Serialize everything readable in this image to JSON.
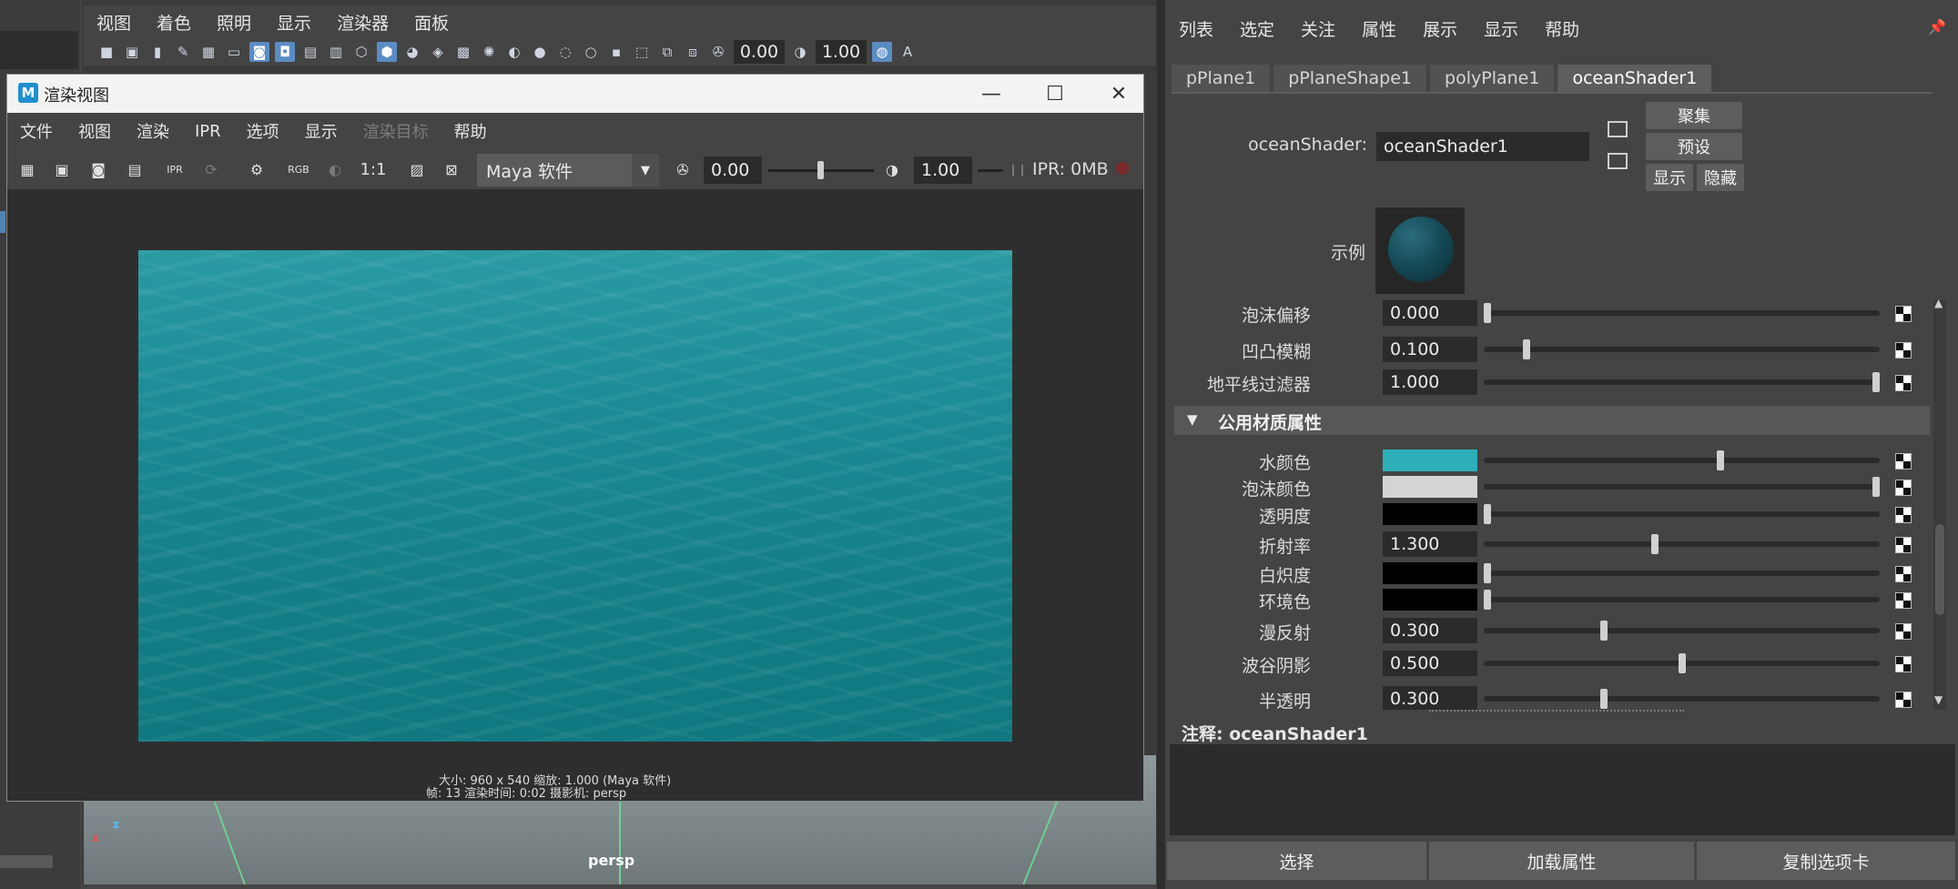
{
  "viewport": {
    "menu": [
      "视图",
      "着色",
      "照明",
      "显示",
      "渲染器",
      "面板"
    ],
    "toolbar": {
      "field1": "0.00",
      "field2": "1.00",
      "badge": "A"
    },
    "label": "persp",
    "axis_x": "x",
    "axis_z": "z"
  },
  "render_view": {
    "title": "渲染视图",
    "logo": "M",
    "window_controls": {
      "minimize": "—",
      "maximize": "☐",
      "close": "✕"
    },
    "menu": [
      "文件",
      "视图",
      "渲染",
      "IPR",
      "选项",
      "显示",
      "渲染目标",
      "帮助"
    ],
    "toolbar": {
      "rgb": "RGB",
      "ratio": "1:1",
      "renderer": "Maya 软件",
      "exposure": "0.00",
      "gamma": "1.00",
      "exposure_level": 0.5,
      "gamma_level": 0.0,
      "ipr": "IPR: 0MB"
    },
    "info_line1": "大小: 960 x 540 缩放: 1.000     (Maya 软件)",
    "info_line2": "帧: 13      渲染时间: 0:02      摄影机: persp",
    "image_colors": {
      "top": "#2a9aa3",
      "bottom": "#0f7880"
    }
  },
  "attr_editor": {
    "menu": [
      "列表",
      "选定",
      "关注",
      "属性",
      "展示",
      "显示",
      "帮助"
    ],
    "tabs": [
      "pPlane1",
      "pPlaneShape1",
      "polyPlane1",
      "oceanShader1"
    ],
    "active_tab": 3,
    "node_label": "oceanShader:",
    "node_name": "oceanShader1",
    "buttons": {
      "focus": "聚集",
      "preset": "预设",
      "show": "显示",
      "hide": "隐藏"
    },
    "sample_label": "示例",
    "rows_top": [
      {
        "label": "泡沫偏移",
        "value": "0.000",
        "level": 0.0
      },
      {
        "label": "凹凸模糊",
        "value": "0.100",
        "level": 0.1
      },
      {
        "label": "地平线过滤器",
        "value": "1.000",
        "level": 1.0
      }
    ],
    "section_title": "公用材质属性",
    "rows_common": [
      {
        "label": "水颜色",
        "color": "#2cafb9",
        "level": 0.6
      },
      {
        "label": "泡沫颜色",
        "color": "#d4d4d4",
        "level": 1.0
      },
      {
        "label": "透明度",
        "color": "#000000",
        "level": 0.0
      },
      {
        "label": "折射率",
        "value": "1.300",
        "level": 0.43
      },
      {
        "label": "白炽度",
        "color": "#000000",
        "level": 0.0
      },
      {
        "label": "环境色",
        "color": "#000000",
        "level": 0.0
      },
      {
        "label": "漫反射",
        "value": "0.300",
        "level": 0.3
      },
      {
        "label": "波谷阴影",
        "value": "0.500",
        "level": 0.5
      },
      {
        "label": "半透明",
        "value": "0.300",
        "level": 0.3
      }
    ],
    "notes_label": "注释:  oceanShader1",
    "bottom_buttons": [
      "选择",
      "加载属性",
      "复制选项卡"
    ]
  }
}
